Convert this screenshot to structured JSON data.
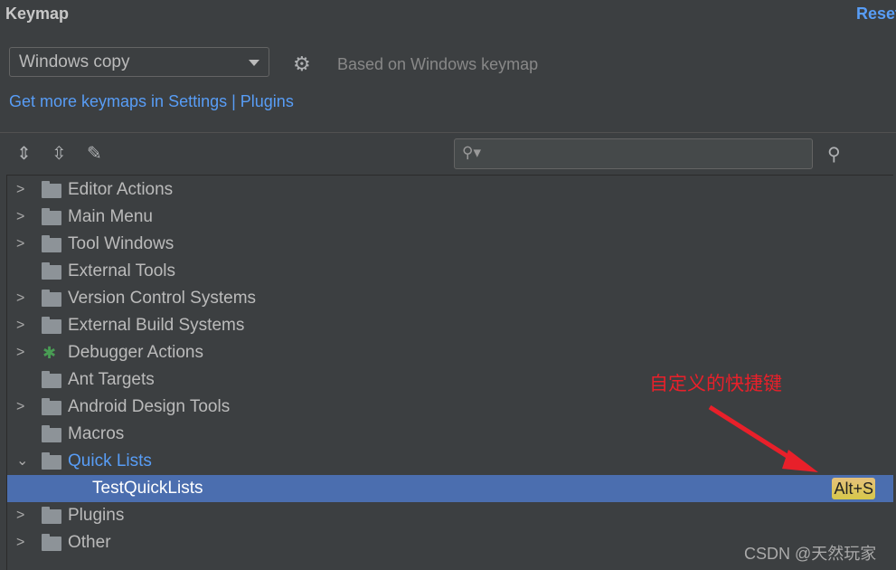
{
  "header": {
    "title": "Keymap",
    "reset_label": "Reset"
  },
  "keymap": {
    "selected": "Windows copy",
    "based_on": "Based on Windows keymap",
    "plugins_link": "Get more keymaps in Settings | Plugins"
  },
  "toolbar": {
    "expand_all": "expand-all-icon",
    "collapse_all": "collapse-all-icon",
    "edit": "pencil-icon"
  },
  "search": {
    "value": "",
    "placeholder": ""
  },
  "tree": [
    {
      "label": "Editor Actions",
      "expandable": true
    },
    {
      "label": "Main Menu",
      "expandable": true
    },
    {
      "label": "Tool Windows",
      "expandable": true
    },
    {
      "label": "External Tools",
      "expandable": false
    },
    {
      "label": "Version Control Systems",
      "expandable": true
    },
    {
      "label": "External Build Systems",
      "expandable": true
    },
    {
      "label": "Debugger Actions",
      "expandable": true
    },
    {
      "label": "Ant Targets",
      "expandable": false
    },
    {
      "label": "Android Design Tools",
      "expandable": true
    },
    {
      "label": "Macros",
      "expandable": false
    },
    {
      "label": "Quick Lists",
      "expanded": true
    },
    {
      "label": "TestQuickLists",
      "shortcut": "Alt+S",
      "selected": true
    },
    {
      "label": "Plugins",
      "expandable": true
    },
    {
      "label": "Other",
      "expandable": true
    }
  ],
  "annotation": "自定义的快捷键",
  "watermark": "CSDN @天然玩家",
  "colors": {
    "background": "#3c3f41",
    "selection": "#4b6eaf",
    "link": "#589df6",
    "annotation": "#e8202a"
  }
}
